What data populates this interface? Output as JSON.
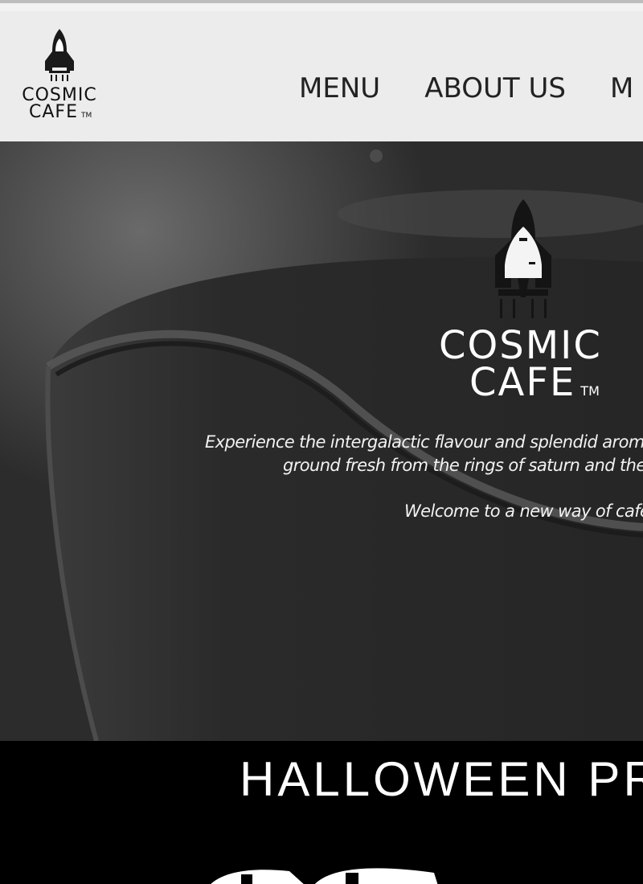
{
  "brand": {
    "name_line1": "COSMIC",
    "name_line2": "CAFE",
    "trademark": "TM"
  },
  "nav": {
    "items": [
      {
        "label": "MENU"
      },
      {
        "label": "ABOUT US"
      },
      {
        "label": "M"
      }
    ]
  },
  "hero": {
    "tagline_line1": "Experience the intergalactic flavour and splendid aroma of",
    "tagline_line2": "ground fresh from the rings of saturn and the m",
    "welcome": "Welcome to a new way of café."
  },
  "promo": {
    "title": "HALLOWEEN PR"
  },
  "icons": {
    "logo": "rocket-icon"
  },
  "colors": {
    "header_bg": "#ececec",
    "hero_bg": "#2a2a2a",
    "promo_bg": "#000000",
    "text_light": "#ffffff",
    "text_dark": "#222222"
  }
}
